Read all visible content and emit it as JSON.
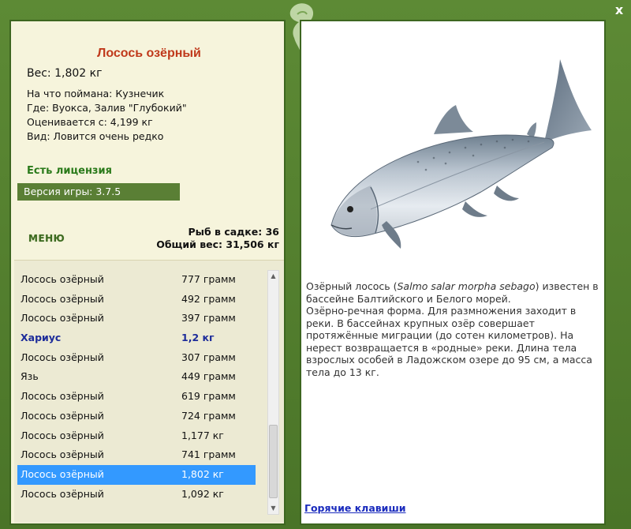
{
  "window": {
    "close_label": "x"
  },
  "fish": {
    "title": "Лосось озёрный",
    "weight_label": "Вес:",
    "weight_value": "1,802 кг",
    "caught_with_label": "На что поймана:",
    "caught_with_value": "Кузнечик",
    "location_label": "Где:",
    "location_value": "Вуокса, Залив \"Глубокий\"",
    "valued_from_label": "Оценивается с:",
    "valued_from_value": "4,199 кг",
    "kind_label": "Вид:",
    "kind_value": "Ловится очень редко"
  },
  "license": "Есть лицензия",
  "version": "Версия игры: 3.7.5",
  "menu_label": "МЕНЮ",
  "stats": {
    "fish_count_label": "Рыб в садке:",
    "fish_count_value": "36",
    "total_weight_label": "Общий вес:",
    "total_weight_value": "31,506 кг"
  },
  "catch_list": [
    {
      "name": "Лосось озёрный",
      "weight": "777 грамм"
    },
    {
      "name": "Лосось озёрный",
      "weight": "492 грамм"
    },
    {
      "name": "Лосось озёрный",
      "weight": "397 грамм"
    },
    {
      "name": "Хариус",
      "weight": "1,2 кг",
      "highlight": true
    },
    {
      "name": "Лосось озёрный",
      "weight": "307 грамм"
    },
    {
      "name": "Язь",
      "weight": "449 грамм"
    },
    {
      "name": "Лосось озёрный",
      "weight": "619 грамм"
    },
    {
      "name": "Лосось озёрный",
      "weight": "724 грамм"
    },
    {
      "name": "Лосось озёрный",
      "weight": "1,177 кг"
    },
    {
      "name": "Лосось озёрный",
      "weight": "741 грамм"
    },
    {
      "name": "Лосось озёрный",
      "weight": "1,802 кг",
      "selected": true
    },
    {
      "name": "Лосось озёрный",
      "weight": "1,092 кг"
    }
  ],
  "description": {
    "line1_pre": "Озёрный лосось (",
    "line1_latin": "Salmo salar morpha sebago",
    "line1_post": ") известен в бассейне Балтийского и Белого морей.",
    "body": "Озёрно-речная форма. Для размножения заходит в реки. В бассейнах крупных озёр совершает протяжённые миграции (до сотен километров). На нерест возвращается в «родные» реки. Длина тела взрослых особей в Ладожском озере до 95 см, а масса тела до 13 кг."
  },
  "hotkeys_label": "Горячие клавиши",
  "icons": {
    "emblem": "fish-emblem-icon",
    "close": "close-icon",
    "scroll_up": "arrow-up-icon",
    "scroll_down": "arrow-down-icon"
  },
  "colors": {
    "frame": "#4f7a2c",
    "title": "#c0391b",
    "license": "#2a7a1a",
    "selected_row": "#3399ff",
    "highlight_row": "#1d2c9a",
    "link": "#1a2bbd"
  }
}
